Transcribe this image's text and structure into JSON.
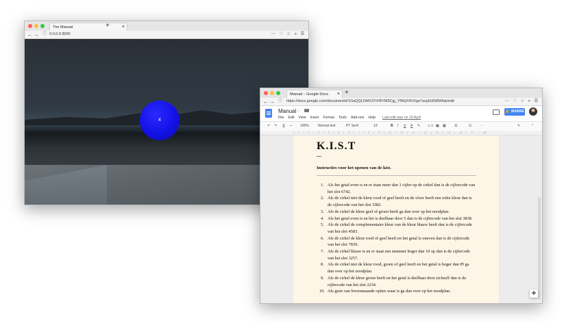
{
  "browser1": {
    "tab_title": "The Manual",
    "url": "0.0.0.0:3000",
    "nav_right": "⋯ ♡ ☆ » ☰",
    "scene": {
      "ball_label": "4",
      "ball_color": "#1414ee"
    }
  },
  "browser2": {
    "tab_title": "Manual – Google Docs",
    "url": "https://docs.google.com/document/d/1GaQQLDMX37rFBYM3Cgj_YNKjX4OXge7acpl2dS85Mqk/edit",
    "nav_right": "⋯ ♡ ☆ » ☰",
    "docs": {
      "title": "Manual",
      "menus": [
        "File",
        "Edit",
        "View",
        "Insert",
        "Format",
        "Tools",
        "Add-ons",
        "Help"
      ],
      "last_edit": "Last edit was on 18 April",
      "share_label": "SHARE",
      "toolbar": {
        "zoom": "100%",
        "style": "Normal text",
        "font": "PT Serif",
        "size": "13"
      },
      "accent_color": "#4285f4"
    },
    "document": {
      "heading": "K.I.S.T",
      "subheading": "Instructies voor het openen van de kist.",
      "items": [
        {
          "num": "1.",
          "text": "Als het getal even is en er staat meer dan 1 cijfer op de cirkel dan is de cijfercode van het slot 6742."
        },
        {
          "num": "2.",
          "text": "Als de cirkel niet de kleur rood of geel heeft en de vloer heeft een witte kleur dan is de cijfercode van het slot 3382."
        },
        {
          "num": "3.",
          "text": "Als de cirkel de kleur geel of groen heeft ga dan over op het noodplan."
        },
        {
          "num": "4.",
          "text": "Als het getal even is en het is deelbaar door 5 dan is de cijfercode van het slot 3838."
        },
        {
          "num": "5.",
          "text": "Als de cirkel de complementaire kleur van de kleur blauw heeft dan is de cijfercode van het slot 4583."
        },
        {
          "num": "6.",
          "text": "Als de cirkel de kleur rood of geel heeft en het getal is oneven dan is de cijfercode van het slot 7839."
        },
        {
          "num": "7.",
          "text": "Als de cirkel blauw is en er staat een nummer hoger dan 10 op dan is de cijfercode van het slot 3257."
        },
        {
          "num": "8.",
          "text": "Als de cirkel niet de kleur rood, groen of geel heeft en het getal is hoger dan PI ga dan over op het noodplan."
        },
        {
          "num": "9.",
          "text": "Als de cirkel de kleur groen heeft en het getal is deelbaar door zichzelf dan is de cijfercode van het slot 2234."
        },
        {
          "num": "10.",
          "text": "Als geen van bovenstaande opties waar is ga dan over op het noodplan."
        }
      ]
    }
  }
}
